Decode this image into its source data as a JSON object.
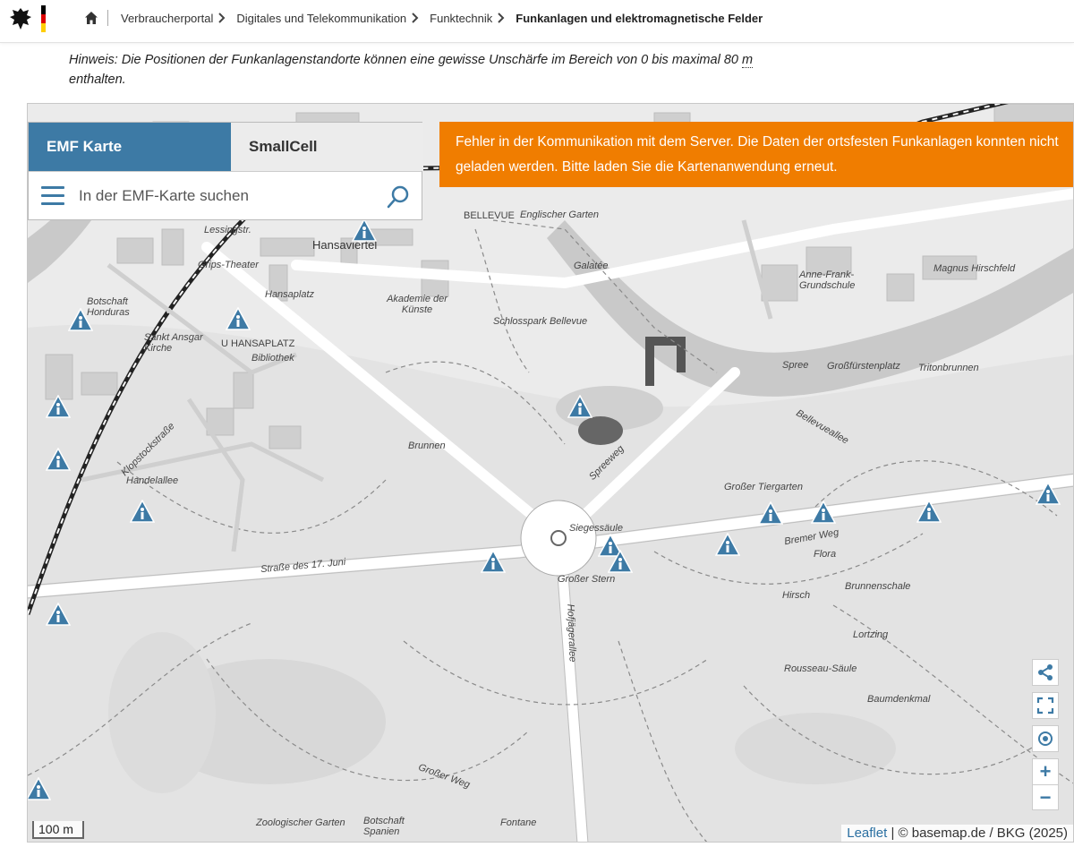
{
  "header": {
    "breadcrumbs": [
      {
        "label": "Verbraucherportal"
      },
      {
        "label": "Digitales und Telekommunikation"
      },
      {
        "label": "Funktechnik"
      },
      {
        "label": "Funkanlagen und elektromagnetische Felder"
      }
    ],
    "flag_colors": [
      "#000000",
      "#dd0000",
      "#ffce00"
    ]
  },
  "hint": {
    "text": "Hinweis: Die Positionen der Funkanlagenstandorte können eine gewisse Unschärfe im Bereich von 0 bis maximal 80 ",
    "unit": "m",
    "text_end": " enthalten."
  },
  "map_panel": {
    "tabs": [
      {
        "label": "EMF Karte"
      },
      {
        "label": "SmallCell"
      }
    ],
    "search_placeholder": "In der EMF-Karte suchen"
  },
  "error_message": "Fehler in der Kommunikation mit dem Server. Die Daten der ortsfesten Funkanlagen konnten nicht geladen werden. Bitte laden Sie die Kartenanwendung erneut.",
  "map_controls": {
    "zoom_in": "+",
    "zoom_out": "−"
  },
  "scale_label": "100 m",
  "attribution": {
    "leaflet": "Leaflet",
    "rest": " | © basemap.de / BKG (2025)"
  },
  "map_labels": [
    "Hansaviertel",
    "Akademie der Künste",
    "Schlosspark Bellevue",
    "Galatée",
    "Botschaft Honduras",
    "Sankt Ansgar Kirche",
    "U HANSAPLATZ",
    "Bibliothek",
    "Grips-Theater",
    "Hansaplatz",
    "Anne-Frank-Grundschule",
    "Magnus Hirschfeld",
    "Großfürstenplatz",
    "Tritonbrunnen",
    "Spree",
    "Großer Tiergarten",
    "Siegessäule",
    "Straße des 17. Juni",
    "Flora",
    "Brunnenschale",
    "Hirsch",
    "Lortzing",
    "Rousseau-Säule",
    "Baumdenkmal",
    "Brunnen",
    "Handelallee",
    "Klopstockstraße",
    "Zoologischer Garten",
    "Botschaft Spanien",
    "Fontane",
    "Großer Weg",
    "Hofjägerallee",
    "Spreeweg",
    "Bellevueallee",
    "Englischer Garten",
    "BELLEVUE",
    "Bremer Weg",
    "Großer Stern",
    "Lessingstr."
  ],
  "marker_color": "#3d7aa5"
}
